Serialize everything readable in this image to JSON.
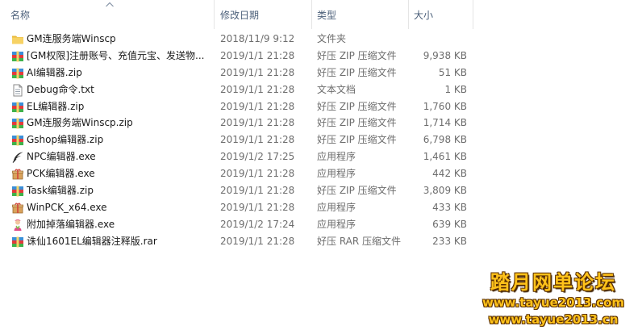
{
  "header": {
    "name": "名称",
    "date": "修改日期",
    "type": "类型",
    "size": "大小",
    "sort_direction": "ascending"
  },
  "files": [
    {
      "icon": "folder-icon",
      "name": "GM连服务端Winscp",
      "date": "2018/11/9 9:12",
      "type": "文件夹",
      "size": ""
    },
    {
      "icon": "zip-archive-icon",
      "name": "[GM权限]注册账号、充值元宝、发送物...",
      "date": "2019/1/1 21:28",
      "type": "好压 ZIP 压缩文件",
      "size": "9,938 KB"
    },
    {
      "icon": "zip-archive-icon",
      "name": "AI编辑器.zip",
      "date": "2019/1/1 21:28",
      "type": "好压 ZIP 压缩文件",
      "size": "51 KB"
    },
    {
      "icon": "text-file-icon",
      "name": "Debug命令.txt",
      "date": "2019/1/1 21:28",
      "type": "文本文档",
      "size": "1 KB"
    },
    {
      "icon": "zip-archive-icon",
      "name": "EL编辑器.zip",
      "date": "2019/1/1 21:28",
      "type": "好压 ZIP 压缩文件",
      "size": "1,760 KB"
    },
    {
      "icon": "zip-archive-icon",
      "name": "GM连服务端Winscp.zip",
      "date": "2019/1/1 21:28",
      "type": "好压 ZIP 压缩文件",
      "size": "1,714 KB"
    },
    {
      "icon": "zip-archive-icon",
      "name": "Gshop编辑器.zip",
      "date": "2019/1/1 21:28",
      "type": "好压 ZIP 压缩文件",
      "size": "6,798 KB"
    },
    {
      "icon": "feather-icon",
      "name": "NPC编辑器.exe",
      "date": "2019/1/2 17:25",
      "type": "应用程序",
      "size": "1,461 KB"
    },
    {
      "icon": "package-icon",
      "name": "PCK编辑器.exe",
      "date": "2019/1/1 21:28",
      "type": "应用程序",
      "size": "442 KB"
    },
    {
      "icon": "zip-archive-icon",
      "name": "Task编辑器.zip",
      "date": "2019/1/1 21:28",
      "type": "好压 ZIP 压缩文件",
      "size": "3,809 KB"
    },
    {
      "icon": "package-icon",
      "name": "WinPCK_x64.exe",
      "date": "2019/1/1 21:28",
      "type": "应用程序",
      "size": "433 KB"
    },
    {
      "icon": "character-icon",
      "name": "附加掉落编辑器.exe",
      "date": "2019/1/2 17:24",
      "type": "应用程序",
      "size": "639 KB"
    },
    {
      "icon": "rar-archive-icon",
      "name": "诛仙1601EL编辑器注释版.rar",
      "date": "2019/1/1 21:28",
      "type": "好压 RAR 压缩文件",
      "size": "233 KB"
    }
  ],
  "watermark": {
    "title": "踏月网单论坛",
    "url1": "www.tayue2013.com",
    "url2": "www.tayue2013.cn"
  },
  "colors": {
    "header_text": "#4c607a",
    "detail_text": "#6d6d6d",
    "folder": "#f5c94b",
    "watermark": "#ffc21a"
  }
}
